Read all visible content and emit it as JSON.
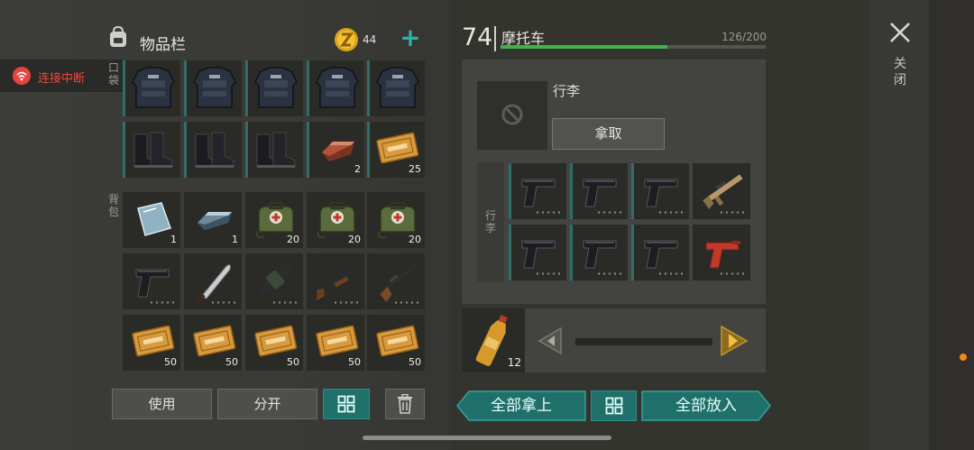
{
  "inventory": {
    "title": "物品栏",
    "icon": "backpack-icon",
    "coins": "44",
    "equipment_label": "口袋",
    "backpack_label": "背包",
    "equip_row1": [
      {
        "item": "body-armor",
        "qty": ""
      },
      {
        "item": "body-armor",
        "qty": ""
      },
      {
        "item": "body-armor",
        "qty": ""
      },
      {
        "item": "body-armor",
        "qty": ""
      },
      {
        "item": "body-armor",
        "qty": ""
      }
    ],
    "equip_row2": [
      {
        "item": "combat-boots",
        "qty": ""
      },
      {
        "item": "combat-boots",
        "qty": ""
      },
      {
        "item": "combat-boots",
        "qty": ""
      },
      {
        "item": "copper-ingot",
        "qty": "2"
      },
      {
        "item": "coupon",
        "qty": "25"
      }
    ],
    "backpack_rows": [
      [
        {
          "item": "glass-plate",
          "qty": "1"
        },
        {
          "item": "steel-ingot",
          "qty": "1"
        },
        {
          "item": "medkit-bag",
          "qty": "20"
        },
        {
          "item": "medkit-bag",
          "qty": "20"
        },
        {
          "item": "medkit-bag",
          "qty": "20"
        }
      ],
      [
        {
          "item": "pistol",
          "qty": ""
        },
        {
          "item": "machete",
          "qty": ""
        },
        {
          "item": "grenade-launcher",
          "qty": ""
        },
        {
          "item": "shotgun",
          "qty": ""
        },
        {
          "item": "rifle",
          "qty": ""
        }
      ],
      [
        {
          "item": "coupon",
          "qty": "50"
        },
        {
          "item": "coupon",
          "qty": "50"
        },
        {
          "item": "coupon",
          "qty": "50"
        },
        {
          "item": "coupon",
          "qty": "50"
        },
        {
          "item": "coupon",
          "qty": "50"
        }
      ]
    ],
    "use_label": "使用",
    "split_label": "分开"
  },
  "status": {
    "disconnect_text": "连接中断",
    "icon": "wifi-off-icon",
    "color": "#e9473d"
  },
  "vehicle": {
    "level": "74",
    "name": "摩托车",
    "capacity_text": "126/200",
    "capacity_fraction": 0.63,
    "luggage_title": "行李",
    "take_label": "拿取",
    "luggage_tab": "行李",
    "luggage_rows": [
      [
        {
          "item": "pistol"
        },
        {
          "item": "pistol"
        },
        {
          "item": "pistol"
        },
        {
          "item": "assault-rifle"
        }
      ],
      [
        {
          "item": "pistol"
        },
        {
          "item": "pistol"
        },
        {
          "item": "pistol"
        },
        {
          "item": "flare-gun"
        }
      ]
    ],
    "bottle_qty": "12",
    "take_all_label": "全部拿上",
    "put_all_label": "全部放入"
  },
  "close_label": "关闭",
  "colors": {
    "accent_teal": "#1f6f6a",
    "capacity_green": "#3bb54a"
  }
}
